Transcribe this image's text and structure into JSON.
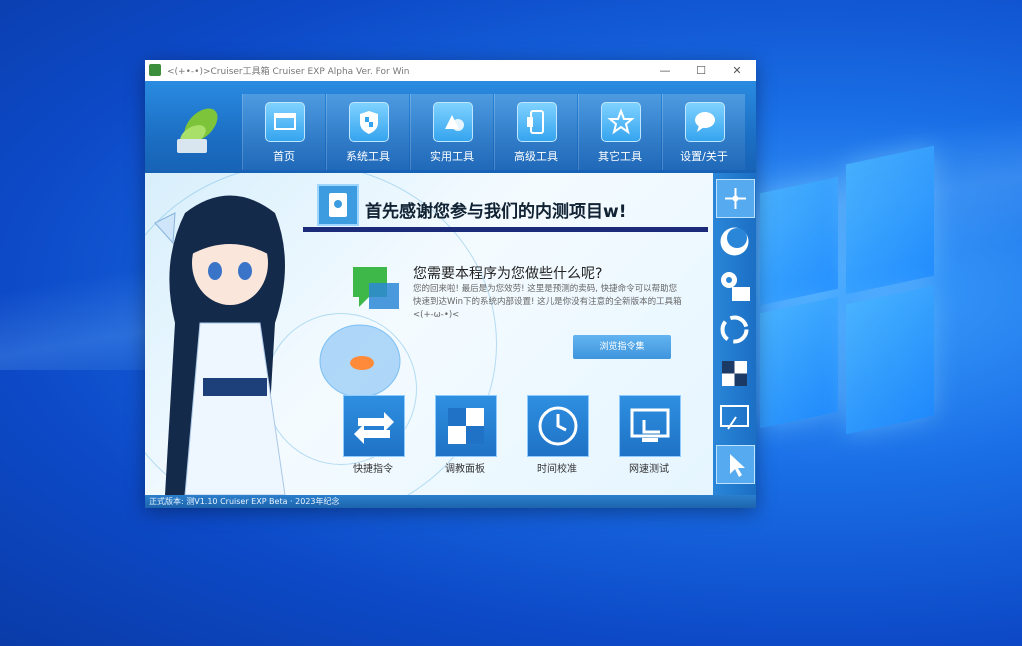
{
  "window": {
    "title": "<(+•-•)>Cruiser工具箱 Cruiser EXP Alpha Ver. For Win",
    "controls": {
      "minimize": "—",
      "maximize": "☐",
      "close": "✕"
    }
  },
  "nav": {
    "tabs": [
      {
        "label": "首页",
        "icon": "window-icon"
      },
      {
        "label": "系统工具",
        "icon": "shield-icon"
      },
      {
        "label": "实用工具",
        "icon": "shapes-icon"
      },
      {
        "label": "高级工具",
        "icon": "phone-icon"
      },
      {
        "label": "其它工具",
        "icon": "star-icon"
      },
      {
        "label": "设置/关于",
        "icon": "chat-bubble-icon"
      }
    ]
  },
  "main": {
    "header_title": "首先感谢您参与我们的内测项目w!",
    "question_title": "您需要本程序为您做些什么呢?",
    "question_desc": "您的回来啦! 最后是为您效劳! 这里是预测的卖码, 快捷命令可以帮助您快速到达Win下的系统内部设置! 这儿是你没有注意的全新版本的工具箱 <(+-ω-•)<",
    "command_button": "浏览指令集",
    "tiles": [
      {
        "label": "快捷指令",
        "icon": "swap-arrows-icon"
      },
      {
        "label": "调教面板",
        "icon": "checker-panel-icon"
      },
      {
        "label": "时间校准",
        "icon": "clock-icon"
      },
      {
        "label": "网速测试",
        "icon": "network-monitor-icon"
      }
    ]
  },
  "sidebar": {
    "buttons": [
      {
        "icon": "move-icon",
        "selected": true
      },
      {
        "icon": "moon-icon",
        "selected": false
      },
      {
        "icon": "gear-list-icon",
        "selected": false
      },
      {
        "icon": "refresh-icon",
        "selected": false
      },
      {
        "icon": "checker-icon",
        "selected": false
      },
      {
        "icon": "screen-icon",
        "selected": false
      },
      {
        "icon": "cursor-icon",
        "selected": false
      }
    ]
  },
  "status": {
    "text": "正式版本: 测V1.10 Cruiser EXP Beta · 2023年纪念"
  },
  "colors": {
    "accent": "#1b6fc4",
    "header_line": "#1b2b7a",
    "desktop": "#1a6fe6"
  }
}
